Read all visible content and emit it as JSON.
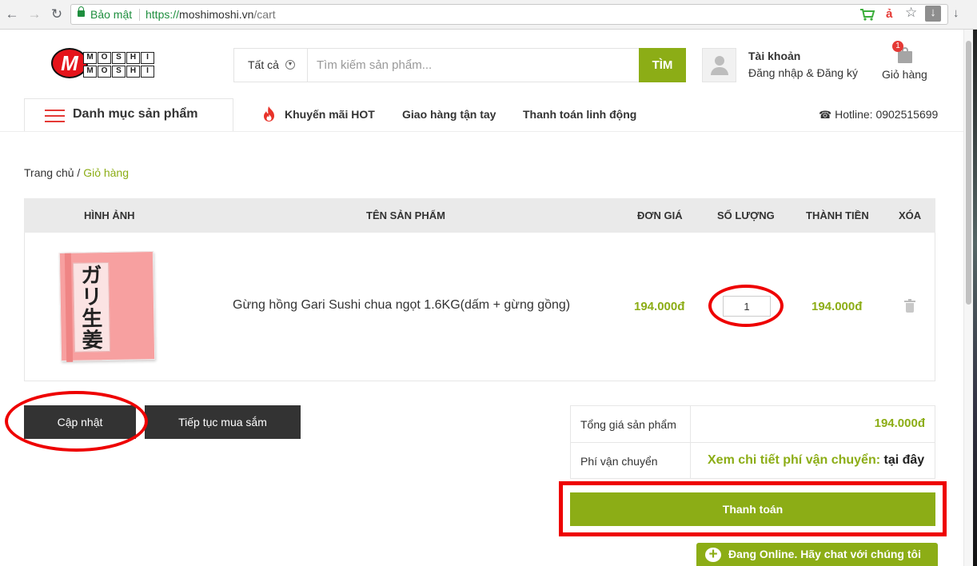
{
  "browser": {
    "secure_label": "Bảo mật",
    "url_scheme": "https://",
    "url_host": "moshimoshi.vn",
    "url_path": "/cart",
    "back_glyph": "←",
    "forward_glyph": "→",
    "reload_glyph": "↻",
    "translate_glyph": "ả",
    "star_glyph": "☆",
    "download_glyph": "↓"
  },
  "header": {
    "logo_letter": "M",
    "logo_row1": [
      "M",
      "O",
      "S",
      "H",
      "I"
    ],
    "logo_row2": [
      "M",
      "O",
      "S",
      "H",
      "I"
    ],
    "search_category": "Tất cả",
    "search_placeholder": "Tìm kiếm sản phẩm...",
    "search_button": "TÌM",
    "account_title": "Tài khoản",
    "account_sub": "Đăng nhập & Đăng ký",
    "cart_count": "1",
    "cart_label": "Giỏ hàng"
  },
  "nav": {
    "category_menu": "Danh mục sản phẩm",
    "links": [
      "Khuyến mãi HOT",
      "Giao hàng tận tay",
      "Thanh toán linh động"
    ],
    "hotline": "Hotline: 0902515699"
  },
  "breadcrumb": {
    "home": "Trang chủ",
    "separator": " / ",
    "current": "Giỏ hàng"
  },
  "cart": {
    "columns": [
      "HÌNH ẢNH",
      "TÊN SẢN PHẨM",
      "ĐƠN GIÁ",
      "SỐ LƯỢNG",
      "THÀNH TIỀN",
      "XÓA"
    ],
    "items": [
      {
        "image_text": "ガリ生姜",
        "name": "Gừng hồng Gari Sushi chua ngọt 1.6KG(dấm + gừng gồng)",
        "unit_price": "194.000đ",
        "quantity": "1",
        "line_total": "194.000đ"
      }
    ]
  },
  "actions": {
    "update": "Cập nhật",
    "continue": "Tiếp tục mua sắm",
    "checkout": "Thanh toán"
  },
  "totals": {
    "subtotal_label": "Tổng giá sản phẩm",
    "subtotal_value": "194.000đ",
    "shipping_label": "Phí vận chuyển",
    "shipping_link": "Xem chi tiết phí vận chuyển:",
    "shipping_here": "tại đây"
  },
  "chat": {
    "label": "Đang Online. Hãy chat với chúng tôi"
  },
  "colors": {
    "accent": "#8cad16",
    "annotation": "#e00000",
    "dark_button": "#333333"
  }
}
